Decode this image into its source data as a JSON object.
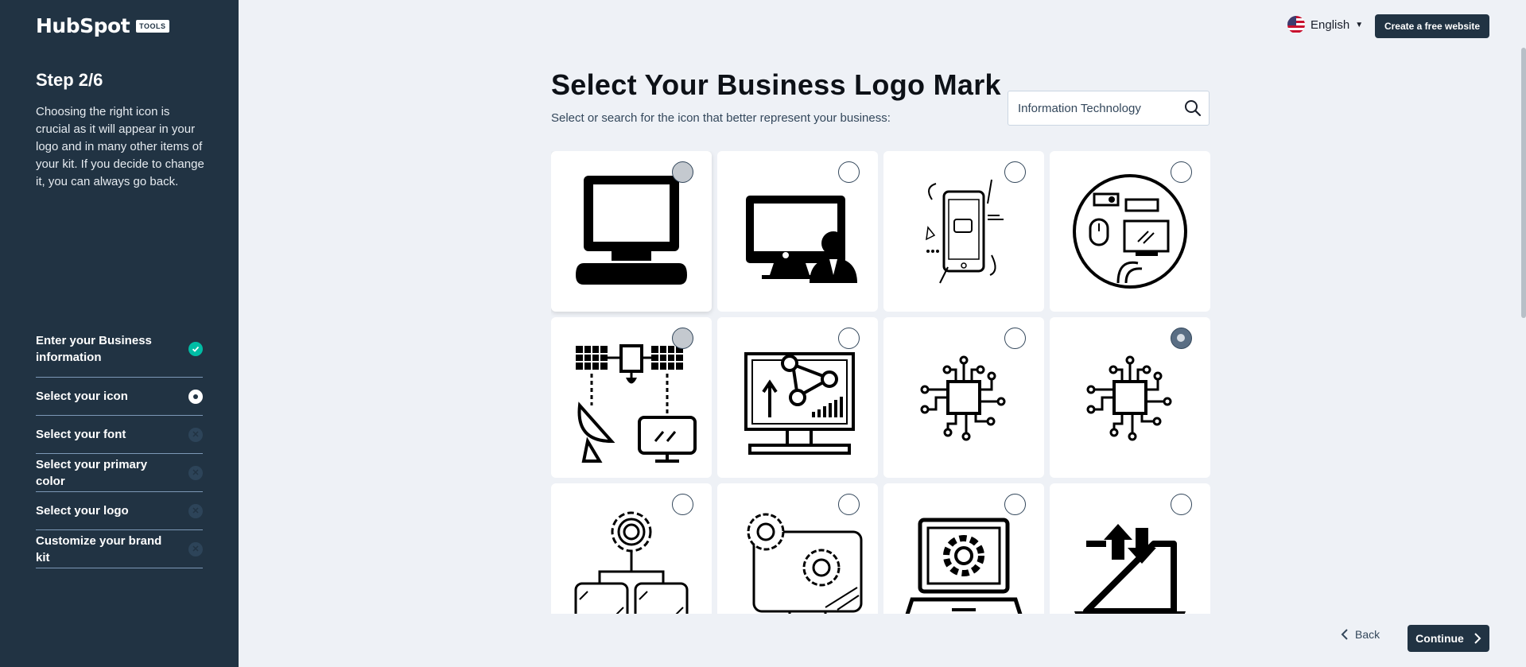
{
  "sidebar": {
    "logo_word": "HubSpot",
    "logo_badge": "TOOLS",
    "step_title": "Step 2/6",
    "step_desc": "Choosing the right icon is crucial as it will appear in your logo and in many other items of your kit. If you decide to change it, you can always go back.",
    "steps": [
      {
        "label": "Enter your Business information",
        "status": "done"
      },
      {
        "label": "Select your icon",
        "status": "current"
      },
      {
        "label": "Select your font",
        "status": "todo"
      },
      {
        "label": "Select your primary color",
        "status": "todo"
      },
      {
        "label": "Select your logo",
        "status": "todo"
      },
      {
        "label": "Customize your brand kit",
        "status": "todo"
      }
    ]
  },
  "header": {
    "language": "English",
    "cta_label": "Create a free website"
  },
  "main": {
    "title": "Select Your Business Logo Mark",
    "subtitle": "Select or search for the icon that better represent your business:",
    "search_value": "Information Technology",
    "icons": [
      {
        "name": "desktop-computer-icon",
        "selected": false
      },
      {
        "name": "computer-user-icon",
        "selected": false
      },
      {
        "name": "smartphone-chat-icon",
        "selected": false
      },
      {
        "name": "tech-devices-circle-icon",
        "selected": false
      },
      {
        "name": "satellite-network-icon",
        "selected": false
      },
      {
        "name": "analytics-monitor-icon",
        "selected": false
      },
      {
        "name": "circuit-chip-icon",
        "selected": false
      },
      {
        "name": "circuit-chip-icon",
        "selected": true
      },
      {
        "name": "gear-hierarchy-icon",
        "selected": false
      },
      {
        "name": "gear-monitor-icon",
        "selected": false
      },
      {
        "name": "laptop-gear-icon",
        "selected": false
      },
      {
        "name": "laptop-upload-download-icon",
        "selected": false
      }
    ]
  },
  "footer": {
    "back_label": "Back",
    "continue_label": "Continue"
  }
}
